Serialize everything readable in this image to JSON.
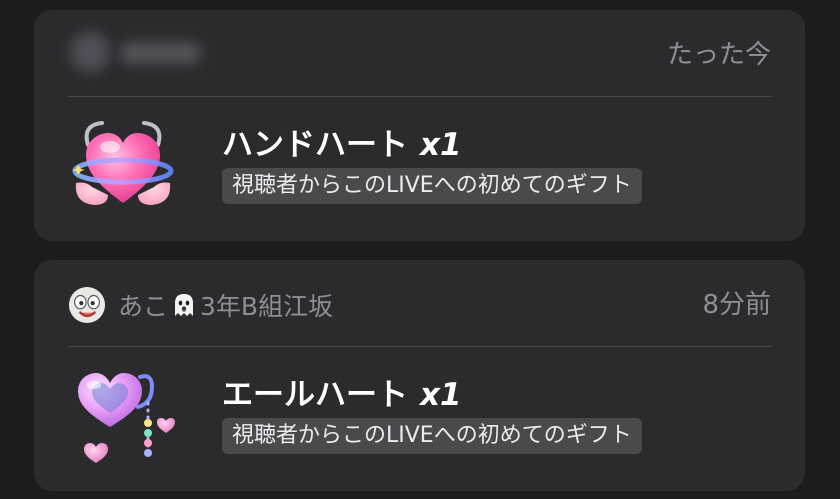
{
  "notifications": [
    {
      "time": "たった今",
      "gift_name": "ハンドハート",
      "quantity": "x1",
      "badge": "視聴者からこのLIVEへの初めてのギフト",
      "gift_icon": "hand-heart-icon"
    },
    {
      "sender": {
        "name_prefix": "あこ",
        "name_suffix": "3年B組江坂",
        "emoji_icon": "ghost-icon"
      },
      "time": "8分前",
      "gift_name": "エールハート",
      "quantity": "x1",
      "badge": "視聴者からこのLIVEへの初めてのギフト",
      "gift_icon": "cheer-heart-icon"
    }
  ]
}
